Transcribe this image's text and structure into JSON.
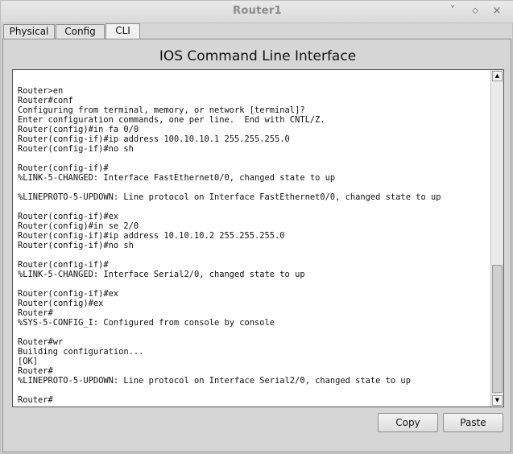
{
  "window": {
    "title": "Router1",
    "controls": {
      "minimize": "˅",
      "maximize": "◇",
      "close": "×"
    }
  },
  "tabs": [
    {
      "label": "Physical"
    },
    {
      "label": "Config"
    },
    {
      "label": "CLI",
      "active": true
    }
  ],
  "panel": {
    "heading": "IOS Command Line Interface"
  },
  "terminal": {
    "lines": [
      "Router>en",
      "Router#conf",
      "Configuring from terminal, memory, or network [terminal]?",
      "Enter configuration commands, one per line.  End with CNTL/Z.",
      "Router(config)#in fa 0/0",
      "Router(config-if)#ip address 100.10.10.1 255.255.255.0",
      "Router(config-if)#no sh",
      "",
      "Router(config-if)#",
      "%LINK-5-CHANGED: Interface FastEthernet0/0, changed state to up",
      "",
      "%LINEPROTO-5-UPDOWN: Line protocol on Interface FastEthernet0/0, changed state to up",
      "",
      "Router(config-if)#ex",
      "Router(config)#in se 2/0",
      "Router(config-if)#ip address 10.10.10.2 255.255.255.0",
      "Router(config-if)#no sh",
      "",
      "Router(config-if)#",
      "%LINK-5-CHANGED: Interface Serial2/0, changed state to up",
      "",
      "Router(config-if)#ex",
      "Router(config)#ex",
      "Router#",
      "%SYS-5-CONFIG_I: Configured from console by console",
      "",
      "Router#wr",
      "Building configuration...",
      "[OK]",
      "Router#",
      "%LINEPROTO-5-UPDOWN: Line protocol on Interface Serial2/0, changed state to up",
      "",
      "Router#"
    ],
    "scroll_position": 1.0
  },
  "buttons": {
    "copy": "Copy",
    "paste": "Paste"
  },
  "scrollbar": {
    "up_arrow": "▲",
    "down_arrow": "▼"
  }
}
